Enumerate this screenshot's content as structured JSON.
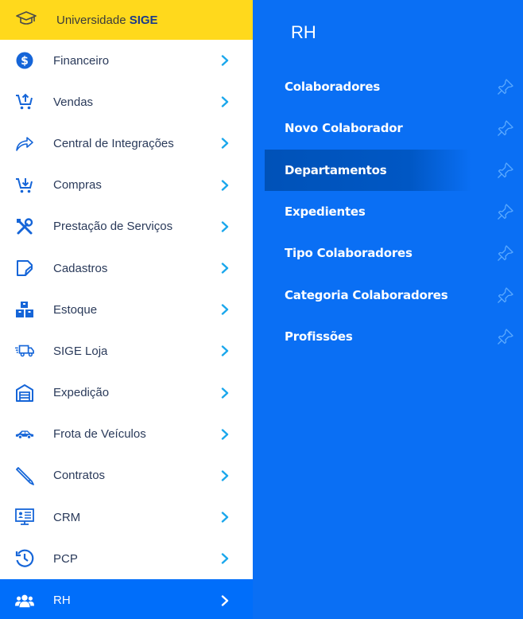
{
  "sidebar": {
    "top": {
      "label_prefix": "Universidade ",
      "label_brand": "SIGE",
      "icon": "graduation-cap-icon"
    },
    "items": [
      {
        "label": "Financeiro",
        "icon": "dollar-circle-icon"
      },
      {
        "label": "Vendas",
        "icon": "cart-up-icon"
      },
      {
        "label": "Central de Integrações",
        "icon": "share-arrow-icon"
      },
      {
        "label": "Compras",
        "icon": "cart-down-icon"
      },
      {
        "label": "Prestação de Serviços",
        "icon": "tools-icon"
      },
      {
        "label": "Cadastros",
        "icon": "edit-doc-icon"
      },
      {
        "label": "Estoque",
        "icon": "boxes-icon"
      },
      {
        "label": "SIGE Loja",
        "icon": "truck-icon"
      },
      {
        "label": "Expedição",
        "icon": "warehouse-icon"
      },
      {
        "label": "Frota de Veículos",
        "icon": "car-icon"
      },
      {
        "label": "Contratos",
        "icon": "pen-icon"
      },
      {
        "label": "CRM",
        "icon": "id-card-icon"
      },
      {
        "label": "PCP",
        "icon": "clock-icon"
      },
      {
        "label": "RH",
        "icon": "users-icon",
        "active": true
      }
    ]
  },
  "submenu": {
    "title": "RH",
    "items": [
      {
        "label": "Colaboradores"
      },
      {
        "label": "Novo Colaborador"
      },
      {
        "label": "Departamentos",
        "active": true
      },
      {
        "label": "Expedientes"
      },
      {
        "label": "Tipo Colaboradores"
      },
      {
        "label": "Categoria Colaboradores"
      },
      {
        "label": "Profissões"
      }
    ]
  },
  "colors": {
    "top_bar": "#ffd91c",
    "accent_blue": "#006efa",
    "submenu_bg": "#0a6ff4",
    "chevron": "#1aa7ec",
    "icon_blue": "#1565d8"
  }
}
